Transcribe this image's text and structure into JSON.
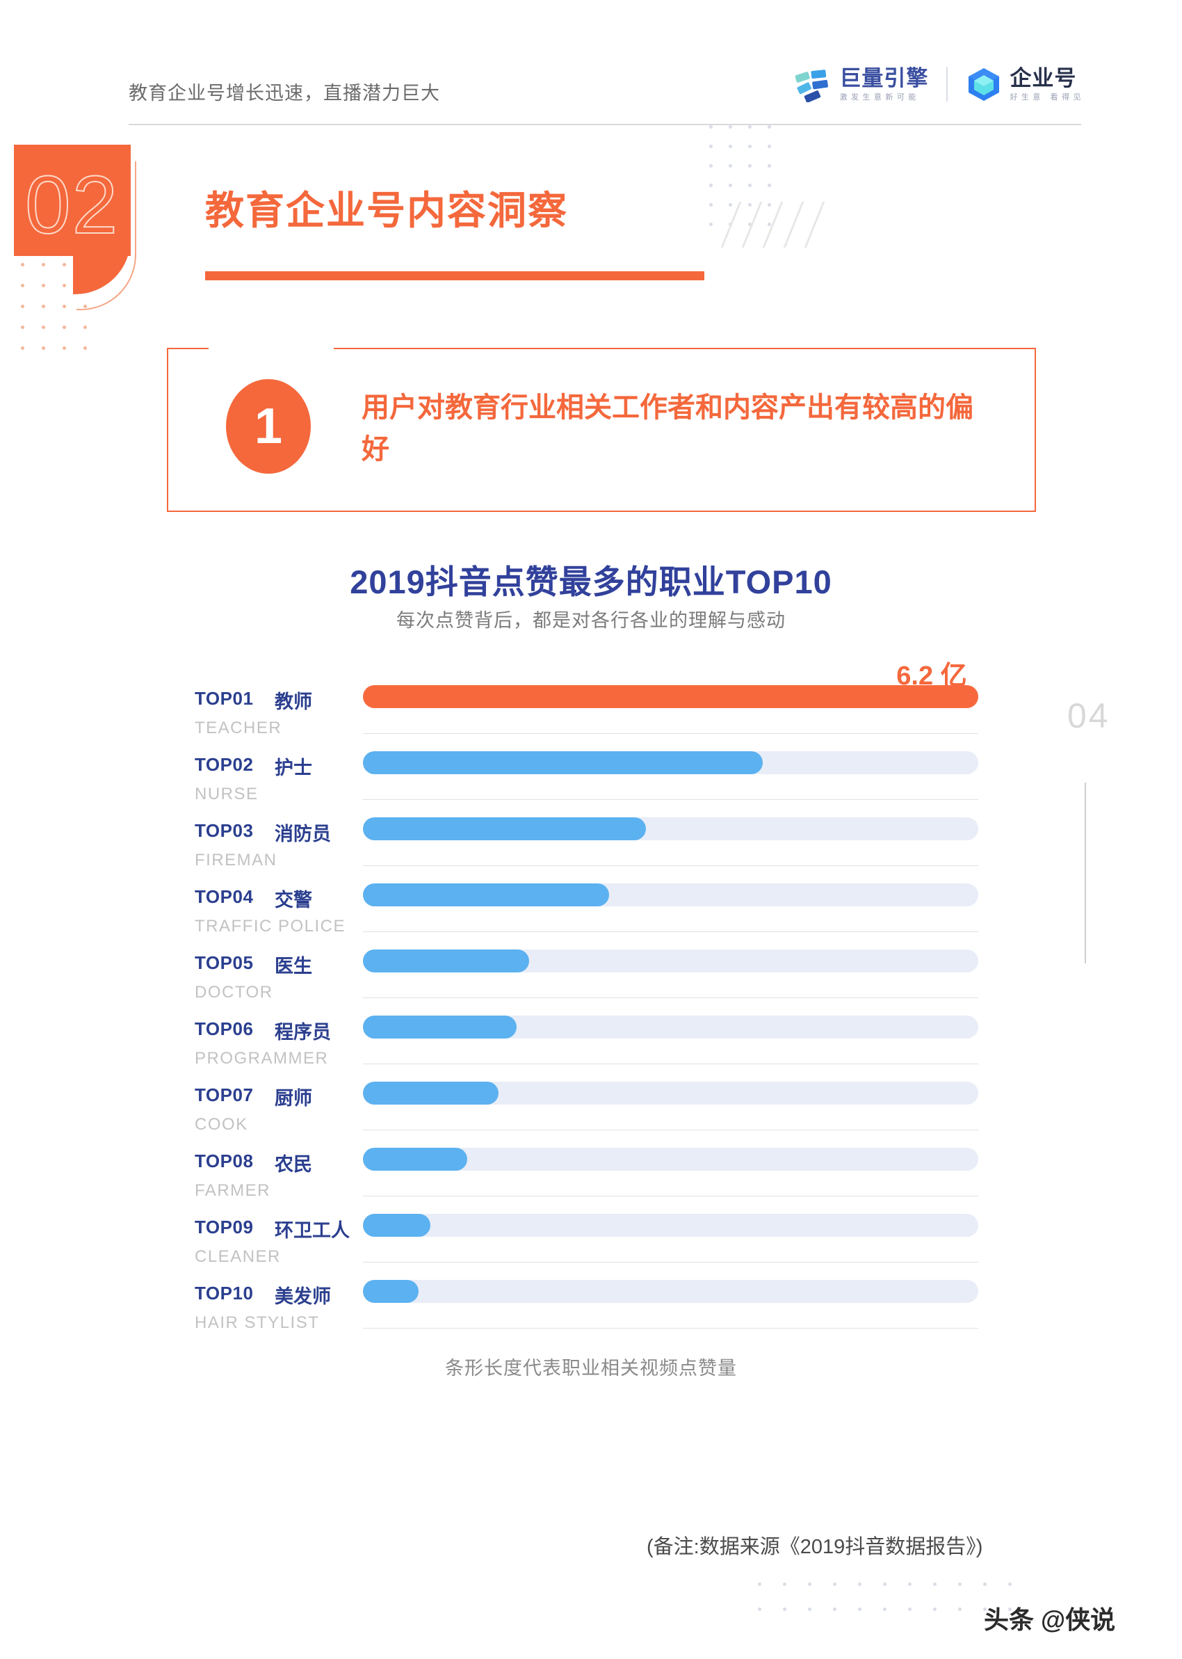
{
  "header": {
    "title": "教育企业号增长迅速，直播潜力巨大",
    "logos": [
      {
        "name": "巨量引擎",
        "tagline": "激发生意新可能"
      },
      {
        "name": "企业号",
        "tagline": "好生意 看得见"
      }
    ]
  },
  "section": {
    "number": "02",
    "title": "教育企业号内容洞察"
  },
  "callout": {
    "badge": "1",
    "text": "用户对教育行业相关工作者和内容产出有较高的偏好"
  },
  "chart_data": {
    "type": "bar",
    "title": "2019抖音点赞最多的职业TOP10",
    "subtitle": "每次点赞背后，都是对各行各业的理解与感动",
    "peak_label": "6.2 亿",
    "note": "条形长度代表职业相关视频点赞量",
    "xlabel": "",
    "ylabel": "",
    "orientation": "horizontal",
    "grid": false,
    "legend": false,
    "categories": [
      "教师",
      "护士",
      "消防员",
      "交警",
      "医生",
      "程序员",
      "厨师",
      "农民",
      "环卫工人",
      "美发师"
    ],
    "values": [
      100,
      65,
      46,
      40,
      27,
      25,
      22,
      17,
      11,
      9
    ],
    "value_unit": "相对条形长度 (%)",
    "rows": [
      {
        "rank": "TOP01",
        "occupation": "教师",
        "occupation_en": "TEACHER",
        "pct": 100,
        "highlight": true
      },
      {
        "rank": "TOP02",
        "occupation": "护士",
        "occupation_en": "NURSE",
        "pct": 65,
        "highlight": false
      },
      {
        "rank": "TOP03",
        "occupation": "消防员",
        "occupation_en": "FIREMAN",
        "pct": 46,
        "highlight": false
      },
      {
        "rank": "TOP04",
        "occupation": "交警",
        "occupation_en": "TRAFFIC POLICE",
        "pct": 40,
        "highlight": false
      },
      {
        "rank": "TOP05",
        "occupation": "医生",
        "occupation_en": "DOCTOR",
        "pct": 27,
        "highlight": false
      },
      {
        "rank": "TOP06",
        "occupation": "程序员",
        "occupation_en": "PROGRAMMER",
        "pct": 25,
        "highlight": false
      },
      {
        "rank": "TOP07",
        "occupation": "厨师",
        "occupation_en": "COOK",
        "pct": 22,
        "highlight": false
      },
      {
        "rank": "TOP08",
        "occupation": "农民",
        "occupation_en": "FARMER",
        "pct": 17,
        "highlight": false
      },
      {
        "rank": "TOP09",
        "occupation": "环卫工人",
        "occupation_en": "CLEANER",
        "pct": 11,
        "highlight": false
      },
      {
        "rank": "TOP10",
        "occupation": "美发师",
        "occupation_en": "HAIR STYLIST",
        "pct": 9,
        "highlight": false
      }
    ]
  },
  "page_number": "04",
  "footnote": "(备注:数据来源《2019抖音数据报告》)",
  "watermark": "头条 @侠说",
  "colors": {
    "accent_orange": "#f4683c",
    "bar_blue": "#5cb1f0",
    "bar_hot": "#f7693d",
    "track": "#e8edf7",
    "title_navy": "#31419b",
    "label_navy": "#2b3f8f"
  }
}
